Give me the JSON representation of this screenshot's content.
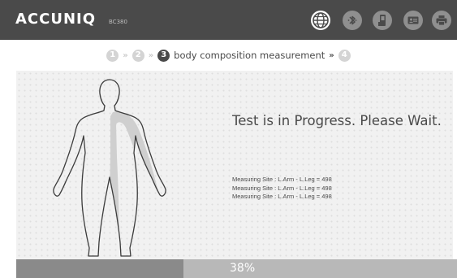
{
  "app": {
    "brand": "ACCUNIQ",
    "model": "BC380"
  },
  "toolbar": {
    "icons": [
      "globe-icon",
      "bluetooth-icon",
      "device-icon",
      "id-card-icon",
      "printer-icon"
    ]
  },
  "steps": {
    "items": [
      {
        "number": "1",
        "state": "done"
      },
      {
        "number": "2",
        "state": "done"
      },
      {
        "number": "3",
        "state": "active",
        "label": "body composition measurement"
      },
      {
        "number": "4",
        "state": "pending"
      }
    ]
  },
  "status": {
    "message": "Test is in Progress. Please Wait."
  },
  "readings": [
    "Measuring Site : L.Arm - L.Leg = 498",
    "Measuring Site : L.Arm - L.Leg = 498",
    "Measuring Site : L.Arm - L.Leg = 498"
  ],
  "progress": {
    "value": 0.38,
    "label": "38%"
  },
  "colors": {
    "header": "#4a4a4a",
    "panel": "#f1f1f1",
    "progress_fill": "#8a8a8a",
    "progress_track": "#b8b8b8"
  }
}
